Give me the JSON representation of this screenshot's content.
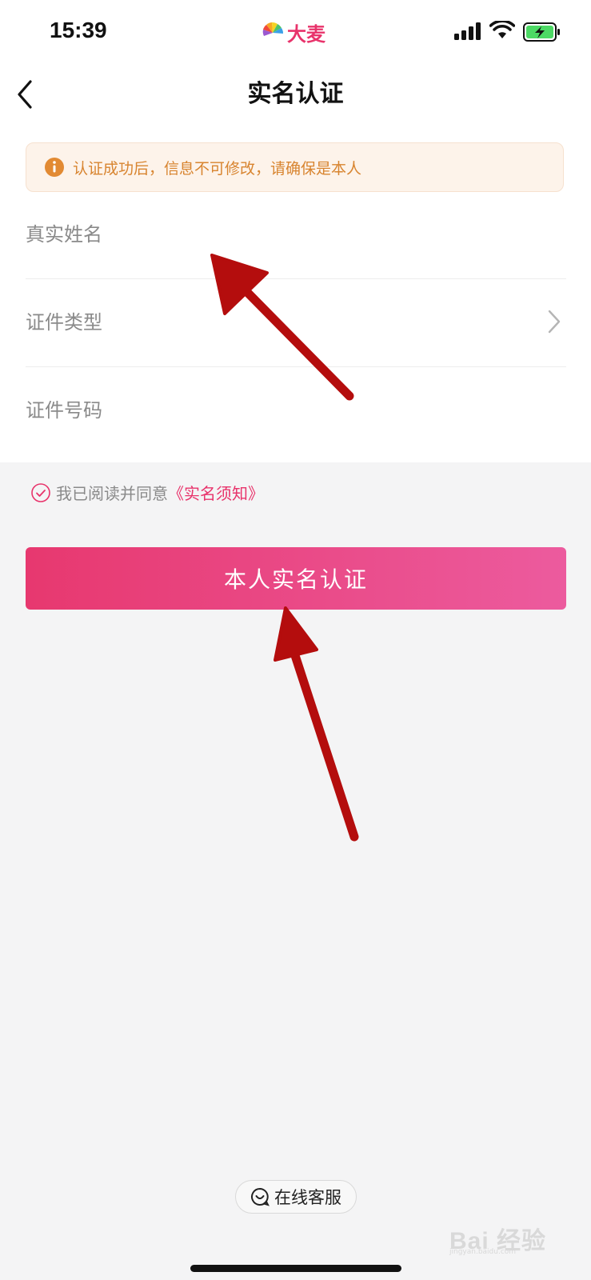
{
  "status_bar": {
    "time": "15:39",
    "brand": "大麦"
  },
  "nav": {
    "title": "实名认证"
  },
  "notice": {
    "text": "认证成功后，信息不可修改，请确保是本人"
  },
  "form": {
    "name_label": "真实姓名",
    "id_type_label": "证件类型",
    "id_number_label": "证件号码"
  },
  "agreement": {
    "prefix": "我已阅读并同意",
    "link": "《实名须知》"
  },
  "submit_button": "本人实名认证",
  "customer_service": "在线客服",
  "watermark": {
    "text": "Bai 经验",
    "sub": "jingyan.baidu.com"
  },
  "colors": {
    "accent": "#e8336b",
    "notice_text": "#d8842f",
    "arrow": "#b40d0d"
  }
}
